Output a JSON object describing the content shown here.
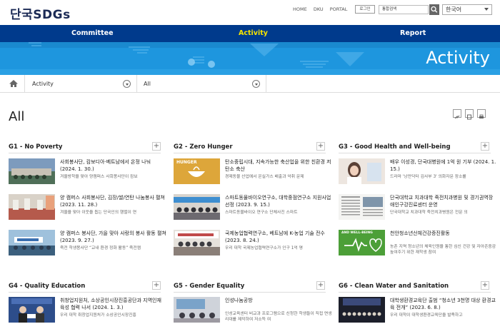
{
  "header": {
    "logo": "단국SDGs",
    "links": [
      "HOME",
      "DKU",
      "PORTAL"
    ],
    "login_label": "로그인",
    "search_placeholder": "통합검색",
    "language": "한국어"
  },
  "nav": [
    "Committee",
    "Activity",
    "Report"
  ],
  "banner_title": "Activity",
  "breadcrumb": {
    "level1": "Activity",
    "level2": "All"
  },
  "page_title": "All",
  "sections": [
    {
      "title": "G1 - No Poverty",
      "items": [
        {
          "title": "사회봉사단, 캄보디아·베트남에서 온정 나눠 (2024. 1. 30.)",
          "desc": "겨울방학을 맞아 양캠퍼스 사회봉사단이 캄보"
        },
        {
          "title": "양 캠퍼스 사회봉사단, 김장/쌀/연탄 나눔봉사 펼쳐 (2023. 11. 28.)",
          "desc": "겨울을 맞아 이웃을 돕는 단국인의 행렬이 연"
        },
        {
          "title": "양 캠퍼스 봉사단, 가을 맞아 사랑의 봉사 활동 펼쳐 (2023. 9. 27.)",
          "desc": "죽전 학생봉사단 “교내 환경 정화 활동” 죽전캠"
        }
      ]
    },
    {
      "title": "G2 - Zero Hunger",
      "items": [
        {
          "title": "탄소중립시대, 지속가능한 축산업을 위한 친환경 저탄소 축산",
          "desc": "경제동물 산업에서 온실가스 배출과 악취 문제"
        },
        {
          "title": "스마트동물바이오연구소, 대학중점연구소 지원사업 선정 (2023. 9. 15.)",
          "desc": "스마트동물바이오 연구소 단체사진 스마트"
        },
        {
          "title": "국제농업협력연구소, 베트남에 K-농업 기술 전수 (2023. 8. 24.)",
          "desc": "우리 대학 국제농업협력연구소가 인구 1억 명"
        }
      ]
    },
    {
      "title": "G3 - Good Health and Well-being",
      "items": [
        {
          "title": "배우 이성경, 단국대병원에 1억 원 기부 (2024. 1. 15.)",
          "desc": "드라마 '낭만닥터 김사부 3' 의화자문 장소를"
        },
        {
          "title": "단국대학교 치과대학 죽전치과병원 및 경기권역장애인구강진료센터 운영",
          "desc": "단국대학교 치과대학 죽전치과병원은 전문 의"
        },
        {
          "title": "천안청소년산체건강증진활동",
          "desc": "농촌 지역 청소년의 체육인원을 통한 심신 건강 및 자아존중감 높여주기 위한 재학생 참여"
        }
      ]
    },
    {
      "title": "G4 - Quality Education",
      "items": [
        {
          "title": "취창업지원처, 소상공인시장진흥공단과 지역인재 육성 협력 나서 (2024. 1. 3.)",
          "desc": "우리 대학 취창업지원처가 소상공인시장진흥"
        }
      ]
    },
    {
      "title": "G5 - Gender Equality",
      "items": [
        {
          "title": "인성나눔공방",
          "desc": "인성교육센터 비교과 프로그램으로 신청한 학생들이 직접 면생리대를 제작하여 저소득 여"
        }
      ]
    },
    {
      "title": "G6 - Clean Water and Sanitation",
      "items": [
        {
          "title": "대학생환경교육단 출범 “청소년 3천명 대상 환경교육 전개” (2023. 6. 8.)",
          "desc": "우리 대학이 대학생환경교육단을 발족하고"
        }
      ]
    }
  ],
  "thumb_labels": {
    "g2_1": "HUNGER",
    "g3_3": "AND WELL-BEING"
  },
  "colors": {
    "nav": "#003a8c",
    "banner": "#1e96de",
    "active_nav": "#f7e400",
    "sdg2": "#dda63a",
    "sdg3": "#4c9f38"
  }
}
